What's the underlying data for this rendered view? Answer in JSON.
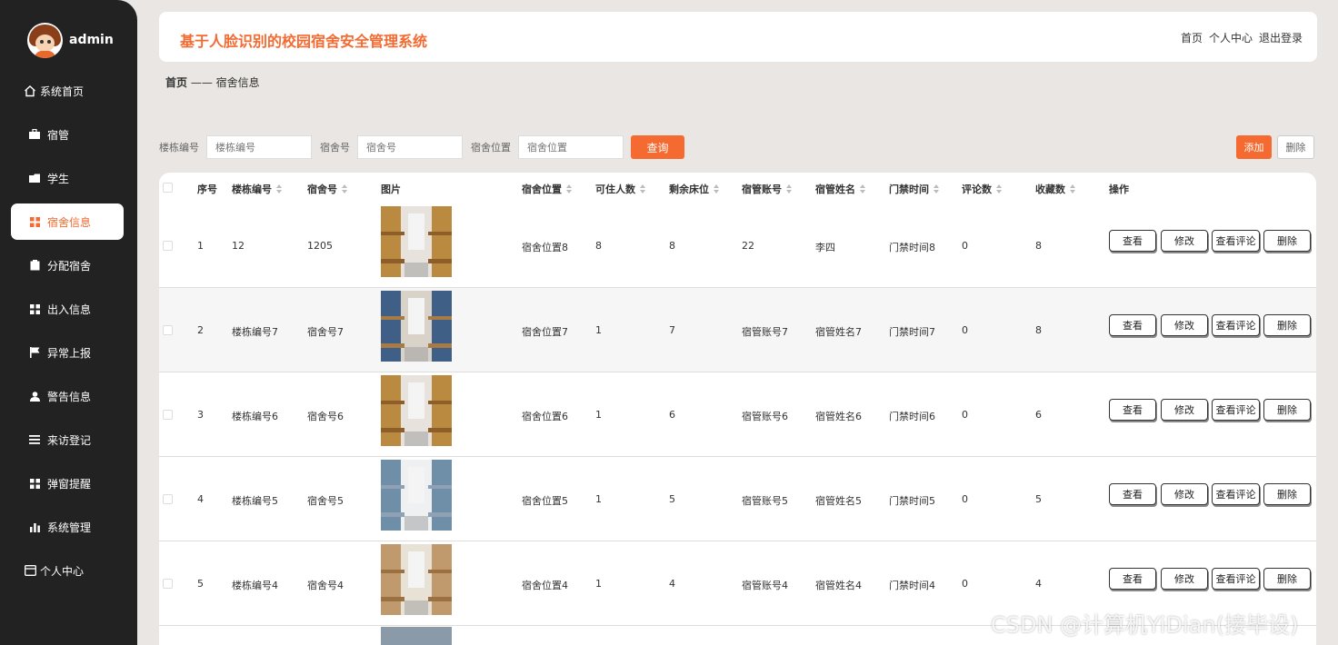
{
  "user": {
    "name": "admin"
  },
  "sidebar": {
    "items": [
      {
        "label": "系统首页",
        "icon": "home-icon"
      },
      {
        "label": "宿管",
        "icon": "briefcase-icon"
      },
      {
        "label": "学生",
        "icon": "folder-icon"
      },
      {
        "label": "宿舍信息",
        "icon": "grid-icon",
        "active": true
      },
      {
        "label": "分配宿舍",
        "icon": "clipboard-icon"
      },
      {
        "label": "出入信息",
        "icon": "grid-icon"
      },
      {
        "label": "异常上报",
        "icon": "flag-icon"
      },
      {
        "label": "警告信息",
        "icon": "user-icon"
      },
      {
        "label": "来访登记",
        "icon": "list-icon"
      },
      {
        "label": "弹窗提醒",
        "icon": "grid-icon"
      },
      {
        "label": "系统管理",
        "icon": "bar-chart-icon"
      },
      {
        "label": "个人中心",
        "icon": "window-icon"
      }
    ]
  },
  "header": {
    "title": "基于人脸识别的校园宿舍安全管理系统",
    "links": [
      "首页",
      "个人中心",
      "退出登录"
    ]
  },
  "breadcrumb": {
    "home": "首页",
    "separator": "——",
    "current": "宿舍信息"
  },
  "search": {
    "building_label": "楼栋编号",
    "building_placeholder": "楼栋编号",
    "room_label": "宿舍号",
    "room_placeholder": "宿舍号",
    "location_label": "宿舍位置",
    "location_placeholder": "宿舍位置",
    "query_button": "查询"
  },
  "actions": {
    "add": "添加",
    "delete": "删除"
  },
  "table": {
    "columns": [
      "序号",
      "楼栋编号",
      "宿舍号",
      "图片",
      "宿舍位置",
      "可住人数",
      "剩余床位",
      "宿管账号",
      "宿管姓名",
      "门禁时间",
      "评论数",
      "收藏数",
      "操作"
    ],
    "row_buttons": [
      "查看",
      "修改",
      "查看评论",
      "删除"
    ],
    "rows": [
      [
        "1",
        "12",
        "1205",
        "宿舍位置8",
        "8",
        "8",
        "22",
        "李四",
        "门禁时间8",
        "0",
        "8"
      ],
      [
        "2",
        "楼栋编号7",
        "宿舍号7",
        "宿舍位置7",
        "1",
        "7",
        "宿管账号7",
        "宿管姓名7",
        "门禁时间7",
        "0",
        "8"
      ],
      [
        "3",
        "楼栋编号6",
        "宿舍号6",
        "宿舍位置6",
        "1",
        "6",
        "宿管账号6",
        "宿管姓名6",
        "门禁时间6",
        "0",
        "6"
      ],
      [
        "4",
        "楼栋编号5",
        "宿舍号5",
        "宿舍位置5",
        "1",
        "5",
        "宿管账号5",
        "宿管姓名5",
        "门禁时间5",
        "0",
        "5"
      ],
      [
        "5",
        "楼栋编号4",
        "宿舍号4",
        "宿舍位置4",
        "1",
        "4",
        "宿管账号4",
        "宿管姓名4",
        "门禁时间4",
        "0",
        "4"
      ]
    ]
  },
  "watermark": "CSDN @计算机YiDian(接毕设)",
  "colors": {
    "accent": "#f46a30",
    "sidebar": "#222222",
    "background": "#e9e6e3"
  }
}
